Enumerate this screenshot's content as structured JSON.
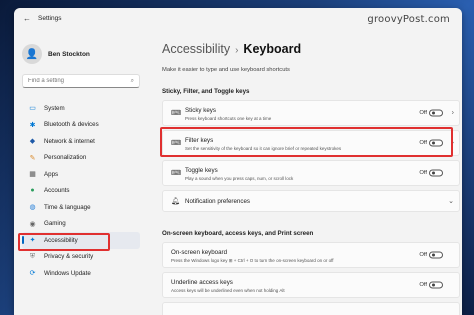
{
  "window": {
    "title": "Settings",
    "watermark": "groovyPost.com"
  },
  "profile": {
    "name": "Ben Stockton"
  },
  "search": {
    "placeholder": "Find a setting"
  },
  "sidebar": {
    "items": [
      {
        "label": "System",
        "icon": "monitor-icon"
      },
      {
        "label": "Bluetooth & devices",
        "icon": "bluetooth-icon"
      },
      {
        "label": "Network & internet",
        "icon": "network-icon"
      },
      {
        "label": "Personalization",
        "icon": "brush-icon"
      },
      {
        "label": "Apps",
        "icon": "apps-icon"
      },
      {
        "label": "Accounts",
        "icon": "person-icon"
      },
      {
        "label": "Time & language",
        "icon": "globe-icon"
      },
      {
        "label": "Gaming",
        "icon": "gamepad-icon"
      },
      {
        "label": "Accessibility",
        "icon": "accessibility-icon"
      },
      {
        "label": "Privacy & security",
        "icon": "shield-icon"
      },
      {
        "label": "Windows Update",
        "icon": "update-icon"
      }
    ],
    "active": "Accessibility"
  },
  "main": {
    "breadcrumb_parent": "Accessibility",
    "breadcrumb_sep": "›",
    "breadcrumb_current": "Keyboard",
    "subtitle": "Make it easier to type and use keyboard shortcuts",
    "section1": "Sticky, Filter, and Toggle keys",
    "section2": "On-screen keyboard, access keys, and Print screen",
    "cards": {
      "sticky": {
        "label": "Sticky keys",
        "desc": "Press keyboard shortcuts one key at a time",
        "state": "Off"
      },
      "filter": {
        "label": "Filter keys",
        "desc": "Set the sensitivity of the keyboard so it can ignore brief or repeated keystrokes",
        "state": "Off"
      },
      "toggle": {
        "label": "Toggle keys",
        "desc": "Play a sound when you press caps, num, or scroll lock",
        "state": "Off"
      },
      "notif": {
        "label": "Notification preferences"
      },
      "osk": {
        "label": "On-screen keyboard",
        "desc": "Press the Windows logo key ⊞ + Ctrl + O to turn the on-screen keyboard on or off",
        "state": "Off"
      },
      "underline": {
        "label": "Underline access keys",
        "desc": "Access keys will be underlined even when not holding Alt",
        "state": "Off"
      }
    }
  }
}
